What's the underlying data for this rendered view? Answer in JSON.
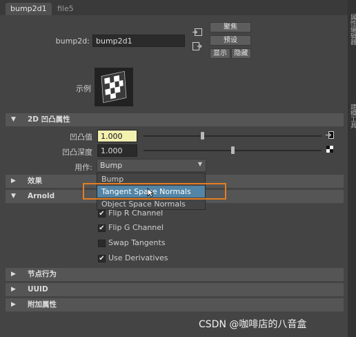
{
  "tabs": [
    {
      "label": "bump2d1"
    },
    {
      "label": "file5"
    }
  ],
  "header": {
    "node_label": "bump2d:",
    "node_value": "bump2d1"
  },
  "buttons": {
    "focus": "聚焦",
    "presets": "预设",
    "show": "显示",
    "hide": "隐藏"
  },
  "sample": {
    "label": "示例"
  },
  "sections": {
    "bump_attrs": "2D 凹凸属性",
    "effects": "效果",
    "arnold": "Arnold",
    "node_behavior": "节点行为",
    "uuid": "UUID",
    "extra_attrs": "附加属性"
  },
  "bump_value": {
    "label": "凹凸值",
    "value": "1.000",
    "slider_fraction": 0.33
  },
  "bump_depth": {
    "label": "凹凸深度",
    "value": "1.000",
    "slider_fraction": 0.5
  },
  "use_as": {
    "label": "用作:",
    "selected": "Bump",
    "options": [
      "Bump",
      "Tangent Space Normals",
      "Object Space Normals"
    ],
    "highlighted": "Tangent Space Normals"
  },
  "arnold": {
    "checkboxes": [
      {
        "label": "Flip R Channel",
        "checked": true
      },
      {
        "label": "Flip G Channel",
        "checked": true
      },
      {
        "label": "Swap Tangents",
        "checked": false
      },
      {
        "label": "Use Derivatives",
        "checked": true
      }
    ]
  },
  "watermark": "CSDN @咖啡店的八音盒",
  "colors": {
    "highlight": "#5285a6",
    "annotation": "#e67e22",
    "bump_field": "#f3f0b0"
  }
}
